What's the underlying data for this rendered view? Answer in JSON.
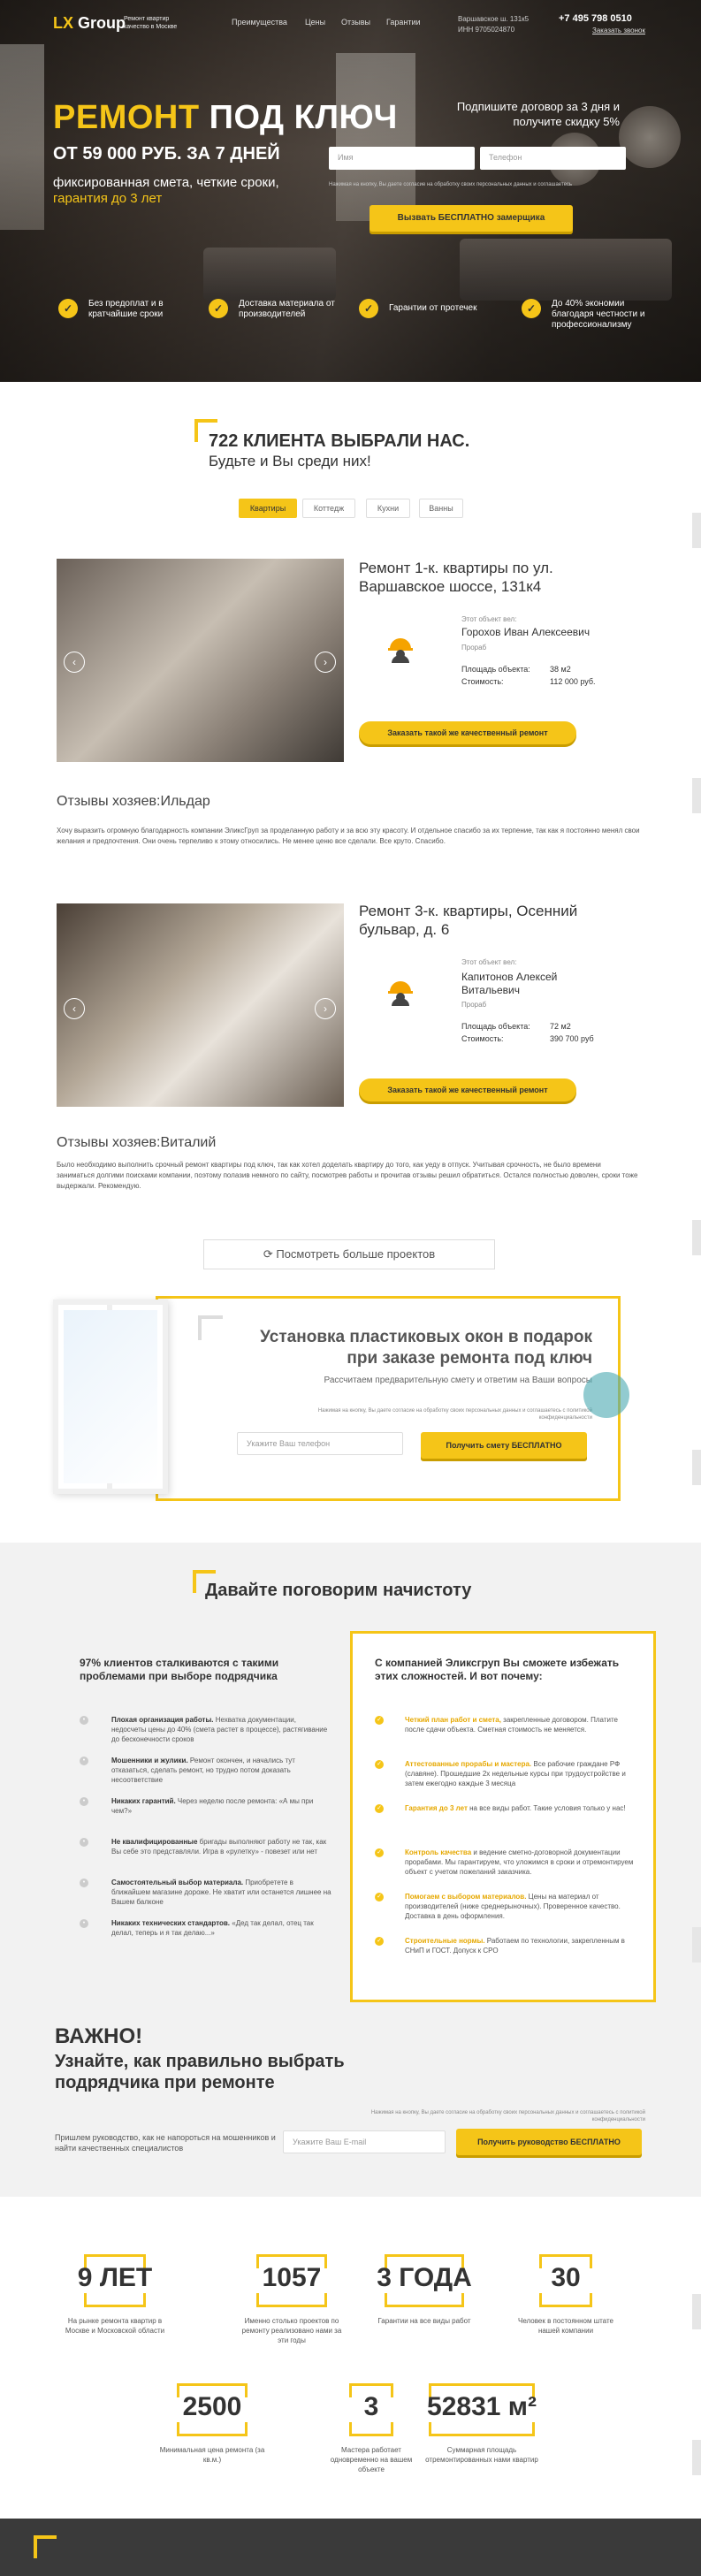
{
  "header": {
    "logo": "LX",
    "logo2": "Group",
    "logo_sub": "Ремонт квартир\nкачество в Москве",
    "nav": [
      "Преимущества",
      "Цены",
      "Отзывы",
      "Гарантии"
    ],
    "address": "Варшавское ш. 131к5",
    "inn": "ИНН 9705024870",
    "phone": "+7 495 798 0510",
    "callback": "Заказать звонок"
  },
  "hero": {
    "title_y": "РЕМОНТ",
    "title_w": "ПОД КЛЮЧ",
    "price": "ОТ 59 000 РУБ. ЗА 7 ДНЕЙ",
    "desc1": "фиксированная смета, четкие сроки,",
    "desc2": "гарантия до 3 лет",
    "offer": "Подпишите договор за 3 дня и получите скидку 5%",
    "name_ph": "Имя",
    "phone_ph": "Телефон",
    "legal": "Нажимая на кнопку, Вы даете согласие на обработку своих персональных данных и соглашаетесь",
    "cta": "Вызвать БЕСПЛАТНО замерщика",
    "features": [
      "Без предоплат и в кратчайшие сроки",
      "Доставка материала от производителей",
      "Гарантии от протечек",
      "До 40% экономии благодаря честности и профессионализму"
    ]
  },
  "clients": {
    "title1": "722 КЛИЕНТА ВЫБРАЛИ НАС.",
    "title2": "Будьте и Вы среди них!",
    "tabs": [
      "Квартиры",
      "Коттедж",
      "Кухни",
      "Ванны"
    ]
  },
  "projects": [
    {
      "title": "Ремонт 1-к. квартиры по ул. Варшавское шоссе, 131к4",
      "led": "Этот объект вел:",
      "foreman": "Горохов Иван Алексеевич",
      "role": "Прораб",
      "area_l": "Площадь объекта:",
      "area": "38 м2",
      "cost_l": "Стоимость:",
      "cost": "112 000 руб.",
      "btn": "Заказать такой же качественный ремонт",
      "rev_t": "Отзывы хозяев:Ильдар",
      "rev": "Хочу выразить огромную благодарность компании ЭликсГруп за проделанную работу и за всю эту красоту. И отдельное спасибо за их терпение, так как я постоянно менял свои желания и предпочтения. Они очень терпеливо к этому относились. Не менее ценю все сделали. Все круто. Спасибо."
    },
    {
      "title": "Ремонт 3-к. квартиры, Осенний бульвар, д. 6",
      "led": "Этот объект вел:",
      "foreman": "Капитонов Алексей Витальевич",
      "role": "Прораб",
      "area_l": "Площадь объекта:",
      "area": "72 м2",
      "cost_l": "Стоимость:",
      "cost": "390 700 руб",
      "btn": "Заказать такой же качественный ремонт",
      "rev_t": "Отзывы хозяев:Виталий",
      "rev": "Было необходимо выполнить срочный ремонт квартиры под ключ, так как хотел доделать квартиру до того, как уеду в отпуск. Учитывая срочность, не было времени заниматься долгими поисками компании, поэтому полазив немного по сайту, посмотрев работы и прочитав отзывы решил обратиться. Остался полностью доволен, сроки тоже выдержали. Рекомендую."
    }
  ],
  "more": "Посмотреть больше проектов",
  "windows": {
    "t1": "Установка пластиковых окон в подарок",
    "t2": "при заказе ремонта под ключ",
    "sub": "Рассчитаем предварительную смету и ответим на Ваши вопросы",
    "legal": "Нажимая на кнопку, Вы даете согласие на обработку своих персональных данных и соглашаетесь с политикой конфиденциальности",
    "ph": "Укажите Ваш телефон",
    "btn": "Получить смету БЕСПЛАТНО"
  },
  "talk": {
    "title": "Давайте поговорим начистоту",
    "left_t": "97% клиентов сталкиваются с такими проблемами при выборе подрядчика",
    "left": [
      [
        "Плохая организация работы.",
        " Нехватка документации, недосчеты цены до 40% (смета растет в процессе), растягивание до бесконечности сроков"
      ],
      [
        "Мошенники и жулики.",
        " Ремонт окончен, и начались тут отказаться, сделать ремонт, но трудно потом доказать несоответствие"
      ],
      [
        "Никаких гарантий.",
        " Через неделю после ремонта: «А мы при чем?»"
      ],
      [
        "Не квалифицированные",
        " бригады выполняют работу не так, как Вы себе это представляли. Игра в «рулетку» - повезет или нет"
      ],
      [
        "Самостоятельный выбор материала.",
        " Приобретете в ближайшем магазине дороже. Не хватит или останется лишнее на Вашем балконе"
      ],
      [
        "Никаких технических стандартов.",
        " «Дед так делал, отец так делал, теперь и я так делаю...»"
      ]
    ],
    "right_t": "С компанией Эликсгруп Вы сможете избежать этих сложностей. И вот почему:",
    "right": [
      [
        "Четкий план работ и смета,",
        " закрепленные договором. Платите после сдачи объекта. Сметная стоимость не меняется."
      ],
      [
        "Аттестованные прорабы и мастера.",
        " Все рабочие граждане РФ (славяне). Прошедшие 2х недельные курсы при трудоустройстве и затем ежегодно каждые 3 месяца"
      ],
      [
        "Гарантия до 3 лет",
        " на все виды работ. Такие условия только у нас!"
      ],
      [
        "Контроль качества",
        " и ведение сметно-договорной документации прорабами. Мы гарантируем, что уложимся в сроки и отремонтируем объект с учетом пожеланий заказчика."
      ],
      [
        "Помогаем с выбором материалов.",
        " Цены на материал от производителей (ниже среднерыночных). Проверенное качество. Доставка в день оформления."
      ],
      [
        "Строительные нормы.",
        " Работаем по технологии, закрепленным в СНиП и ГОСТ. Допуск к СРО"
      ]
    ],
    "imp": "ВАЖНО!",
    "imp2": "Узнайте, как правильно выбрать подрядчика при ремонте",
    "guide": "Пришлем руководство, как не напороться на мошенников и найти качественных специалистов",
    "legal": "Нажимая на кнопку, Вы даете согласие на обработку своих персональных данных и соглашаетесь с политикой конфиденциальности",
    "ph": "Укажите Ваш E-mail",
    "btn": "Получить руководство БЕСПЛАТНО"
  },
  "stats": [
    [
      "9 ЛЕТ",
      "На рынке ремонта квартир в Москве и Московской области"
    ],
    [
      "1057",
      "Именно столько проектов по ремонту реализовано нами за эти годы"
    ],
    [
      "3 ГОДА",
      "Гарантии на все виды работ"
    ],
    [
      "30",
      "Человек в постоянном штате нашей компании"
    ],
    [
      "2500",
      "Минимальная цена ремонта (за кв.м.)"
    ],
    [
      "3",
      "Мастера работает одновременно на вашем объекте"
    ],
    [
      "52831 м²",
      "Суммарная площадь отремонтированных нами квартир"
    ]
  ]
}
